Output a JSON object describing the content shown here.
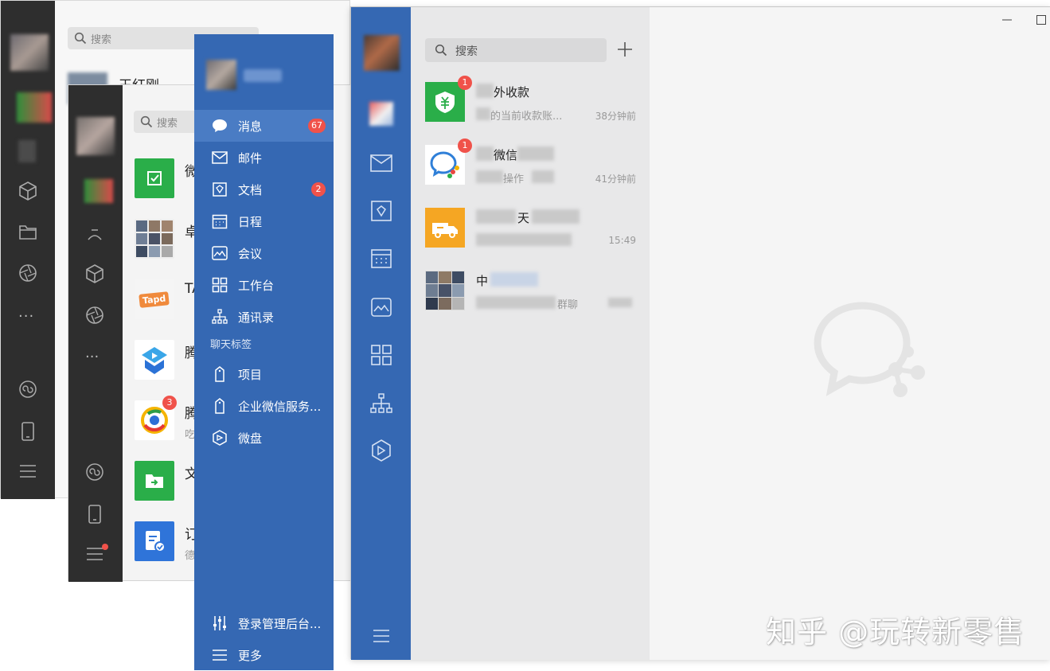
{
  "back_window": {
    "search_placeholder": "搜索",
    "first_contact": "王红刚"
  },
  "second_window": {
    "search_placeholder": "搜索",
    "items": [
      {
        "name": "微",
        "sub": ""
      },
      {
        "name": "卓",
        "sub": ""
      },
      {
        "name": "TA",
        "sub": ""
      },
      {
        "name": "腾",
        "sub": ""
      },
      {
        "name": "腾",
        "sub": "吃",
        "badge": "3"
      },
      {
        "name": "文",
        "sub": ""
      },
      {
        "name": "订",
        "sub": "德"
      }
    ]
  },
  "menu_window": {
    "items": [
      {
        "label": "消息",
        "icon": "chat-icon",
        "badge": "67"
      },
      {
        "label": "邮件",
        "icon": "mail-icon"
      },
      {
        "label": "文档",
        "icon": "document-icon",
        "badge": "2"
      },
      {
        "label": "日程",
        "icon": "calendar-icon"
      },
      {
        "label": "会议",
        "icon": "meeting-icon"
      },
      {
        "label": "工作台",
        "icon": "workbench-icon"
      },
      {
        "label": "通讯录",
        "icon": "contacts-icon"
      }
    ],
    "section_label": "聊天标签",
    "tags": [
      {
        "label": "项目",
        "icon": "tag-icon"
      },
      {
        "label": "企业微信服务...",
        "icon": "tag-icon"
      },
      {
        "label": "微盘",
        "icon": "drive-icon"
      }
    ],
    "bottom": [
      {
        "label": "登录管理后台...",
        "icon": "admin-sliders-icon"
      },
      {
        "label": "更多",
        "icon": "menu-icon"
      }
    ]
  },
  "front_window": {
    "search_placeholder": "搜索",
    "conversations": [
      {
        "name": "外收款",
        "preview": "的当前收款账...",
        "time": "38分钟前",
        "badge": "1"
      },
      {
        "name": "微信",
        "preview": "操作",
        "time": "41分钟前",
        "badge": "1"
      },
      {
        "name": "天",
        "preview": "",
        "time": "15:49"
      },
      {
        "name": "中",
        "preview": "群聊",
        "time": ""
      }
    ]
  },
  "watermark": "知乎 @玩转新零售",
  "colors": {
    "brand_blue": "#3568b3",
    "active_blue": "#4a7cc4",
    "dark_rail": "#2e2e2e",
    "badge_red": "#f0524a"
  }
}
